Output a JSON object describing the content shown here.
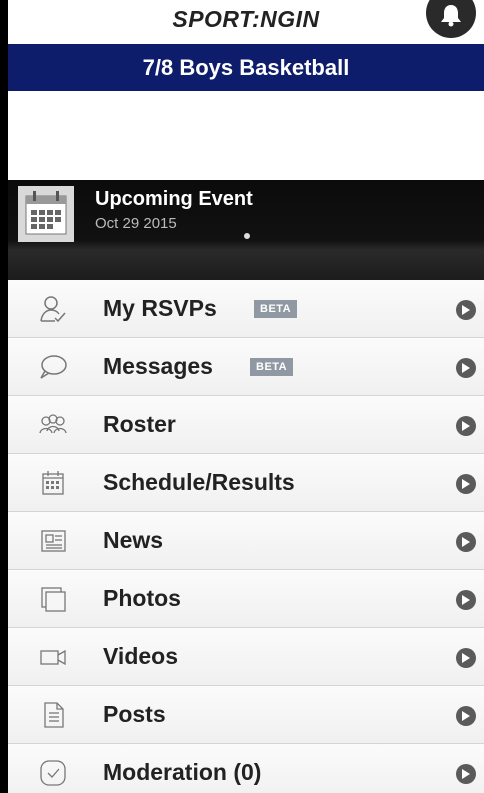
{
  "header": {
    "logo_text": "SPORT:NGIN",
    "team_title": "7/8 Boys Basketball"
  },
  "event": {
    "title": "Upcoming Event",
    "date": "Oct 29 2015"
  },
  "menu": {
    "items": [
      {
        "label": "My RSVPs",
        "badge": "BETA",
        "icon": "person-check-icon"
      },
      {
        "label": "Messages",
        "badge": "BETA",
        "icon": "speech-bubble-icon"
      },
      {
        "label": "Roster",
        "icon": "people-group-icon"
      },
      {
        "label": "Schedule/Results",
        "icon": "calendar-icon"
      },
      {
        "label": "News",
        "icon": "newspaper-icon"
      },
      {
        "label": "Photos",
        "icon": "photos-icon"
      },
      {
        "label": "Videos",
        "icon": "video-camera-icon"
      },
      {
        "label": "Posts",
        "icon": "document-icon"
      },
      {
        "label": "Moderation (0)",
        "icon": "checkmark-circle-icon"
      }
    ]
  },
  "colors": {
    "banner": "#0e1d6b",
    "badge": "#8f98a3",
    "chevron": "#5a5a5a"
  }
}
